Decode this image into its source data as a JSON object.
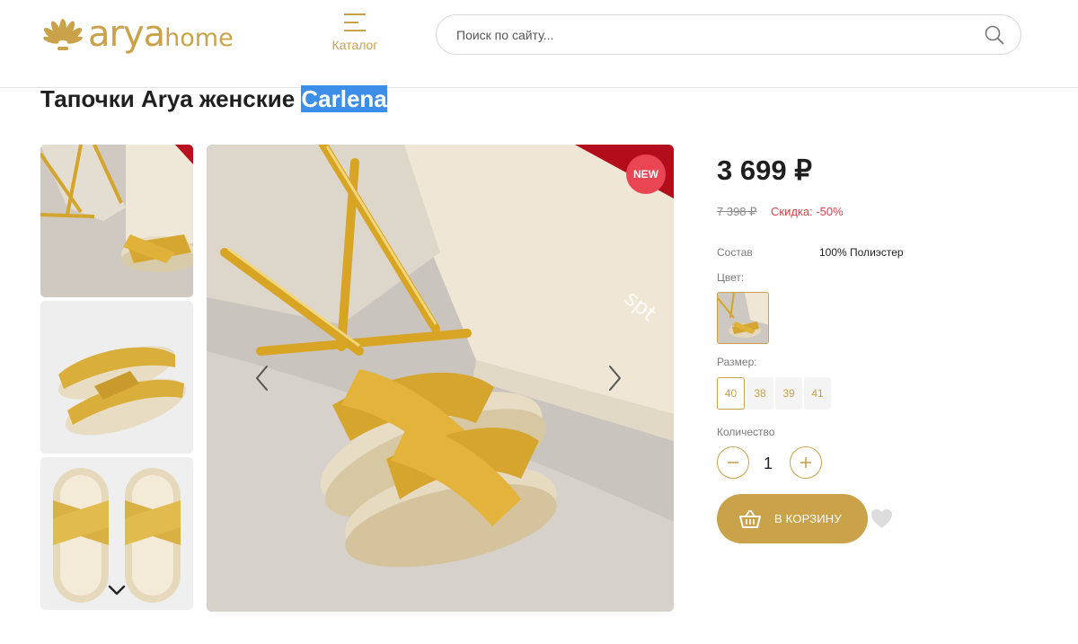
{
  "header": {
    "logo_text": "arya",
    "logo_text_suffix": "home",
    "catalog_label": "Каталог",
    "search_placeholder": "Поиск по сайту..."
  },
  "product": {
    "title_main": "Тапочки Arya женские",
    "title_highlight": "Carlena",
    "badge": "NEW",
    "price": "3 699 ₽",
    "old_price": "7 398 ₽",
    "discount": "Скидка: -50%",
    "spec_label": "Состав",
    "spec_value": "100% Полиэстер",
    "color_label": "Цвет:",
    "size_label": "Размер:",
    "sizes": [
      "40",
      "38",
      "39",
      "41"
    ],
    "selected_size": "40",
    "quantity_label": "Количество",
    "quantity": "1",
    "cart_button": "В КОРЗИНУ",
    "watermark": "spt"
  },
  "colors": {
    "accent": "#c9a24a",
    "badge": "#e94553",
    "discount": "#e0404a",
    "highlight": "#3d8ee8"
  },
  "icons": [
    "logo-icon",
    "menu-icon",
    "search-icon",
    "chevron-left-icon",
    "chevron-right-icon",
    "chevron-down-icon",
    "minus-icon",
    "plus-icon",
    "basket-icon",
    "heart-icon"
  ]
}
